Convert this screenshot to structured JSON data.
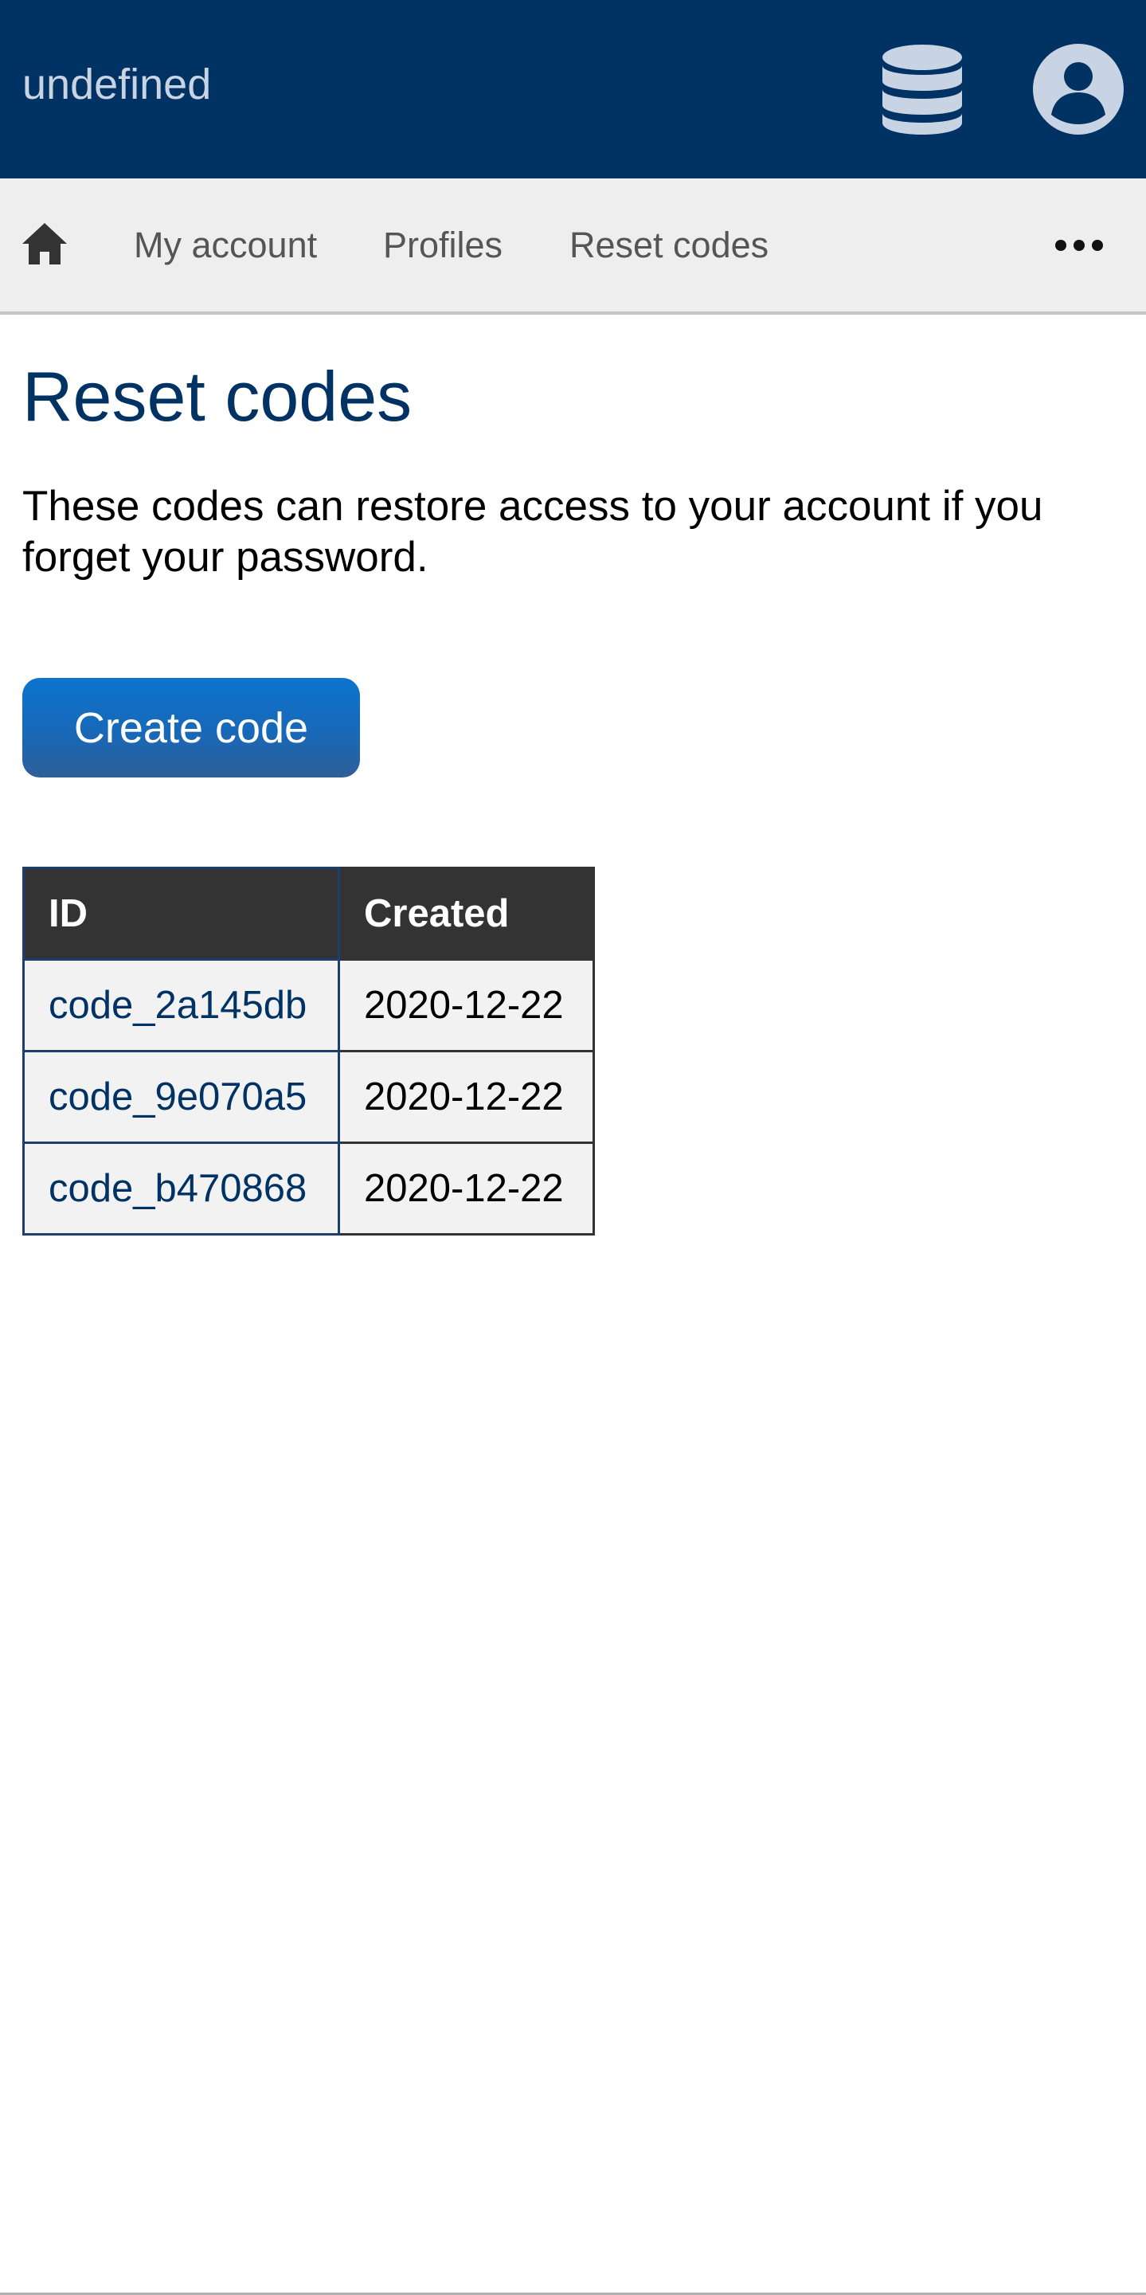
{
  "header": {
    "title": "undefined",
    "db_icon": "database-icon",
    "account_icon": "user-circle-icon",
    "background": "#003264"
  },
  "nav": {
    "home_icon": "home-icon",
    "items": [
      {
        "label": "My account"
      },
      {
        "label": "Profiles"
      },
      {
        "label": "Reset codes"
      }
    ],
    "more_icon": "more-horizontal-icon"
  },
  "main": {
    "title": "Reset codes",
    "description": "These codes can restore access to your account if you forget your password.",
    "create_button_label": "Create code",
    "table": {
      "headers": [
        "ID",
        "Created"
      ],
      "rows": [
        {
          "id": "code_2a145db",
          "created": "2020-12-22"
        },
        {
          "id": "code_9e070a5",
          "created": "2020-12-22"
        },
        {
          "id": "code_b470868",
          "created": "2020-12-22"
        }
      ]
    }
  },
  "colors": {
    "brand": "#003264",
    "button": "#1668b8",
    "table_header": "#333333"
  }
}
